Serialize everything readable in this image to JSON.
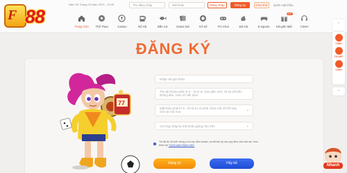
{
  "header": {
    "datetime": "Năm 08 Tháng 03 Năm 2023 - 10:45",
    "username_placeholder": "Tên đăng nhập",
    "password_placeholder": "Mật khẩu",
    "login_label": "Đăng nhập",
    "register_label": "Đăng ký",
    "demo_label": "Chơi thử",
    "forgot_label": "Quên mật khẩu"
  },
  "nav": [
    {
      "label": "Trang Chủ",
      "icon": "home-icon"
    },
    {
      "label": "Thể Thao",
      "icon": "soccer-ball-icon"
    },
    {
      "label": "Casino",
      "icon": "spade-chip-icon"
    },
    {
      "label": "Nổ Hũ",
      "icon": "slot-machine-icon"
    },
    {
      "label": "Bắn Cá",
      "icon": "fish-icon"
    },
    {
      "label": "Game bài",
      "icon": "playing-cards-icon"
    },
    {
      "label": "Xổ Số",
      "icon": "lottery-ball-icon"
    },
    {
      "label": "Trò Chơi",
      "icon": "gamepad-icon"
    },
    {
      "label": "Đá Gà",
      "icon": "rooster-icon"
    },
    {
      "label": "E-Sports",
      "icon": "controller-icon"
    },
    {
      "label": "Khuyến Mãi",
      "icon": "gift-icon",
      "badge": "HOT"
    },
    {
      "label": "CSKH",
      "icon": "headset-icon"
    }
  ],
  "page_title": "ĐĂNG KÝ",
  "form": {
    "referral_placeholder": "Nhập mã giới thiệu",
    "username_placeholder": "Tên tài khoản phải từ 6 - 16 kí tự, bao gồm chữ, số và viết liền không dấu, hoặc số viết dưới",
    "password_placeholder": "Mật khẩu phải từ 6 - 32 ký tự và phải chứa một số kết hợp chữ và chữ hoa",
    "confirm_placeholder": "Vui lòng nhập lại mật khẩu giống như trên",
    "terms_text": "Tôi đã đủ 18 tuổi, đồng ý với các điều khoản, và đã đọc kỹ các quy định của nhà cái. Xem thêm tại",
    "terms_link": "\"chính sách thành viên\"",
    "submit_label": "Đăng ký",
    "cancel_label": "Hủy bỏ"
  },
  "rail": {
    "item1": "CSKH",
    "item2": "TẢI APP",
    "item3": "CSKH"
  },
  "floating_badge": "Nhanh",
  "colors": {
    "accent": "#f05b29",
    "title": "#ef6a33",
    "submit": "#f7a115",
    "cancel": "#2a58e0"
  }
}
